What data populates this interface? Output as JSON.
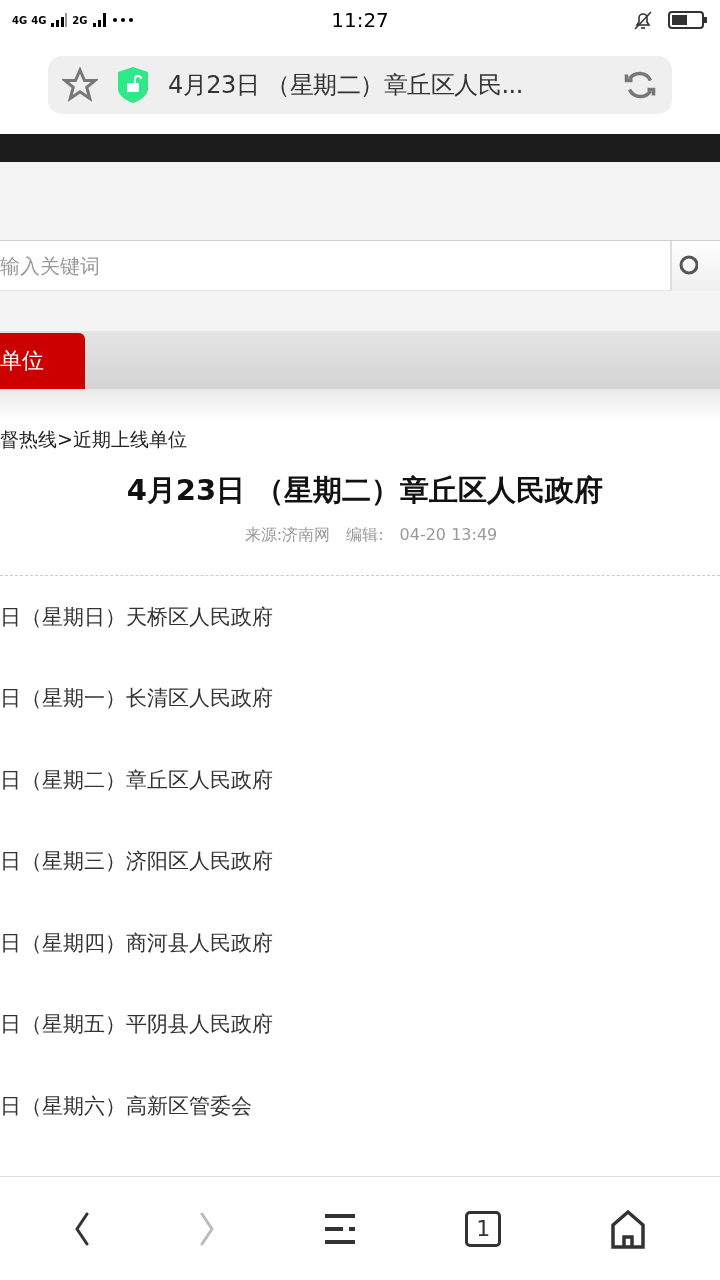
{
  "status_bar": {
    "network_1": "4G",
    "network_2": "4G",
    "network_3": "2G",
    "time": "11:27"
  },
  "address_bar": {
    "title": "4月23日 （星期二）章丘区人民..."
  },
  "search": {
    "placeholder": "输入关键词"
  },
  "tabs": [
    {
      "label": "单位",
      "selected": true
    }
  ],
  "breadcrumb": "督热线>近期上线单位",
  "article": {
    "title": "4月23日 （星期二）章丘区人民政府",
    "source": "来源:济南网",
    "editor": "编辑:",
    "date": "04-20 13:49"
  },
  "links": [
    {
      "text": "日（星期日）天桥区人民政府"
    },
    {
      "text": "日（星期一）长清区人民政府"
    },
    {
      "text": "日（星期二）章丘区人民政府"
    },
    {
      "text": "日（星期三）济阳区人民政府"
    },
    {
      "text": "日（星期四）商河县人民政府"
    },
    {
      "text": "日（星期五）平阴县人民政府"
    },
    {
      "text": "日（星期六）高新区管委会"
    }
  ],
  "toolbar": {
    "back_enabled": true,
    "forward_enabled": false,
    "tab_count": "1"
  }
}
